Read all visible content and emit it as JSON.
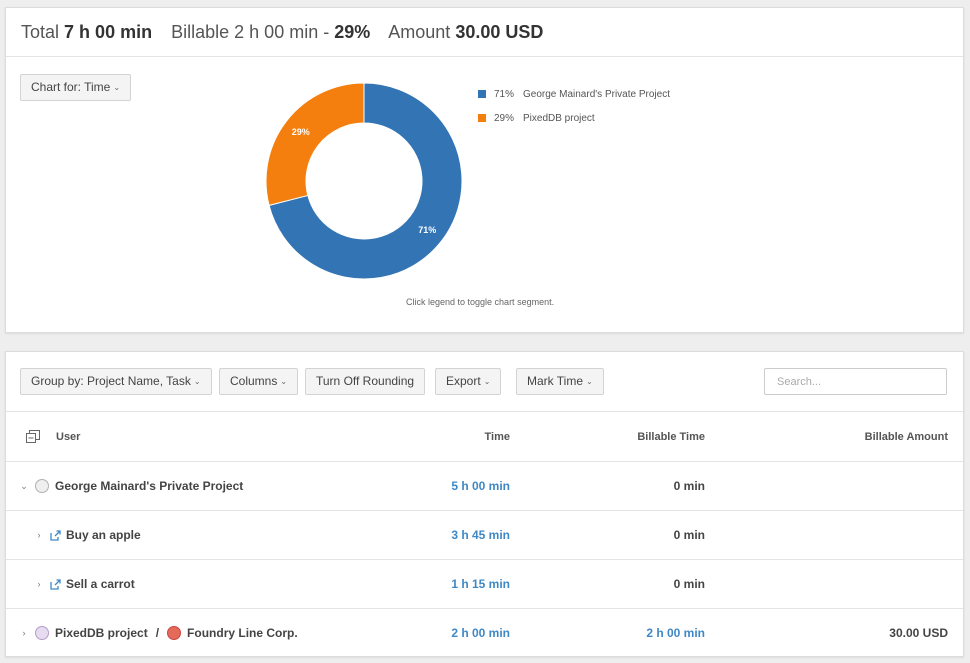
{
  "summary": {
    "total_label": "Total",
    "total_value": "7 h 00 min",
    "billable_label": "Billable",
    "billable_value": "2 h 00 min -",
    "billable_pct": "29%",
    "amount_label": "Amount",
    "amount_value": "30.00 USD"
  },
  "chart_button": {
    "label": "Chart for: Time"
  },
  "chart_data": {
    "type": "pie",
    "categories": [
      "George Mainard's Private Project",
      "PixedDB project"
    ],
    "values": [
      71,
      29
    ],
    "labels": [
      "71%",
      "29%"
    ],
    "colors": [
      "#3274b4",
      "#f47f0e"
    ],
    "hint": "Click legend to toggle chart segment."
  },
  "toolbar": {
    "group_by": "Group by: Project Name, Task",
    "columns": "Columns",
    "rounding": "Turn Off Rounding",
    "export": "Export",
    "mark_time": "Mark Time",
    "search_placeholder": "Search..."
  },
  "table": {
    "columns": [
      "User",
      "Time",
      "Billable Time",
      "Billable Amount"
    ],
    "rows": [
      {
        "name": "George Mainard's Private Project",
        "time": "5 h 00 min",
        "billable_time": "0 min",
        "billable_amount": ""
      },
      {
        "name": "Buy an apple",
        "time": "3 h 45 min",
        "billable_time": "0 min",
        "billable_amount": ""
      },
      {
        "name": "Sell a carrot",
        "time": "1 h 15 min",
        "billable_time": "0 min",
        "billable_amount": ""
      },
      {
        "name": "PixedDB project",
        "separator": "/",
        "client": "Foundry Line Corp.",
        "time": "2 h 00 min",
        "billable_time": "2 h 00 min",
        "billable_amount": "30.00 USD"
      }
    ]
  },
  "icons": {
    "chevron_down": "chevron-down-icon",
    "chevron_right": "chevron-right-icon",
    "collapse": "collapse-all-icon",
    "task": "task-link-icon"
  }
}
